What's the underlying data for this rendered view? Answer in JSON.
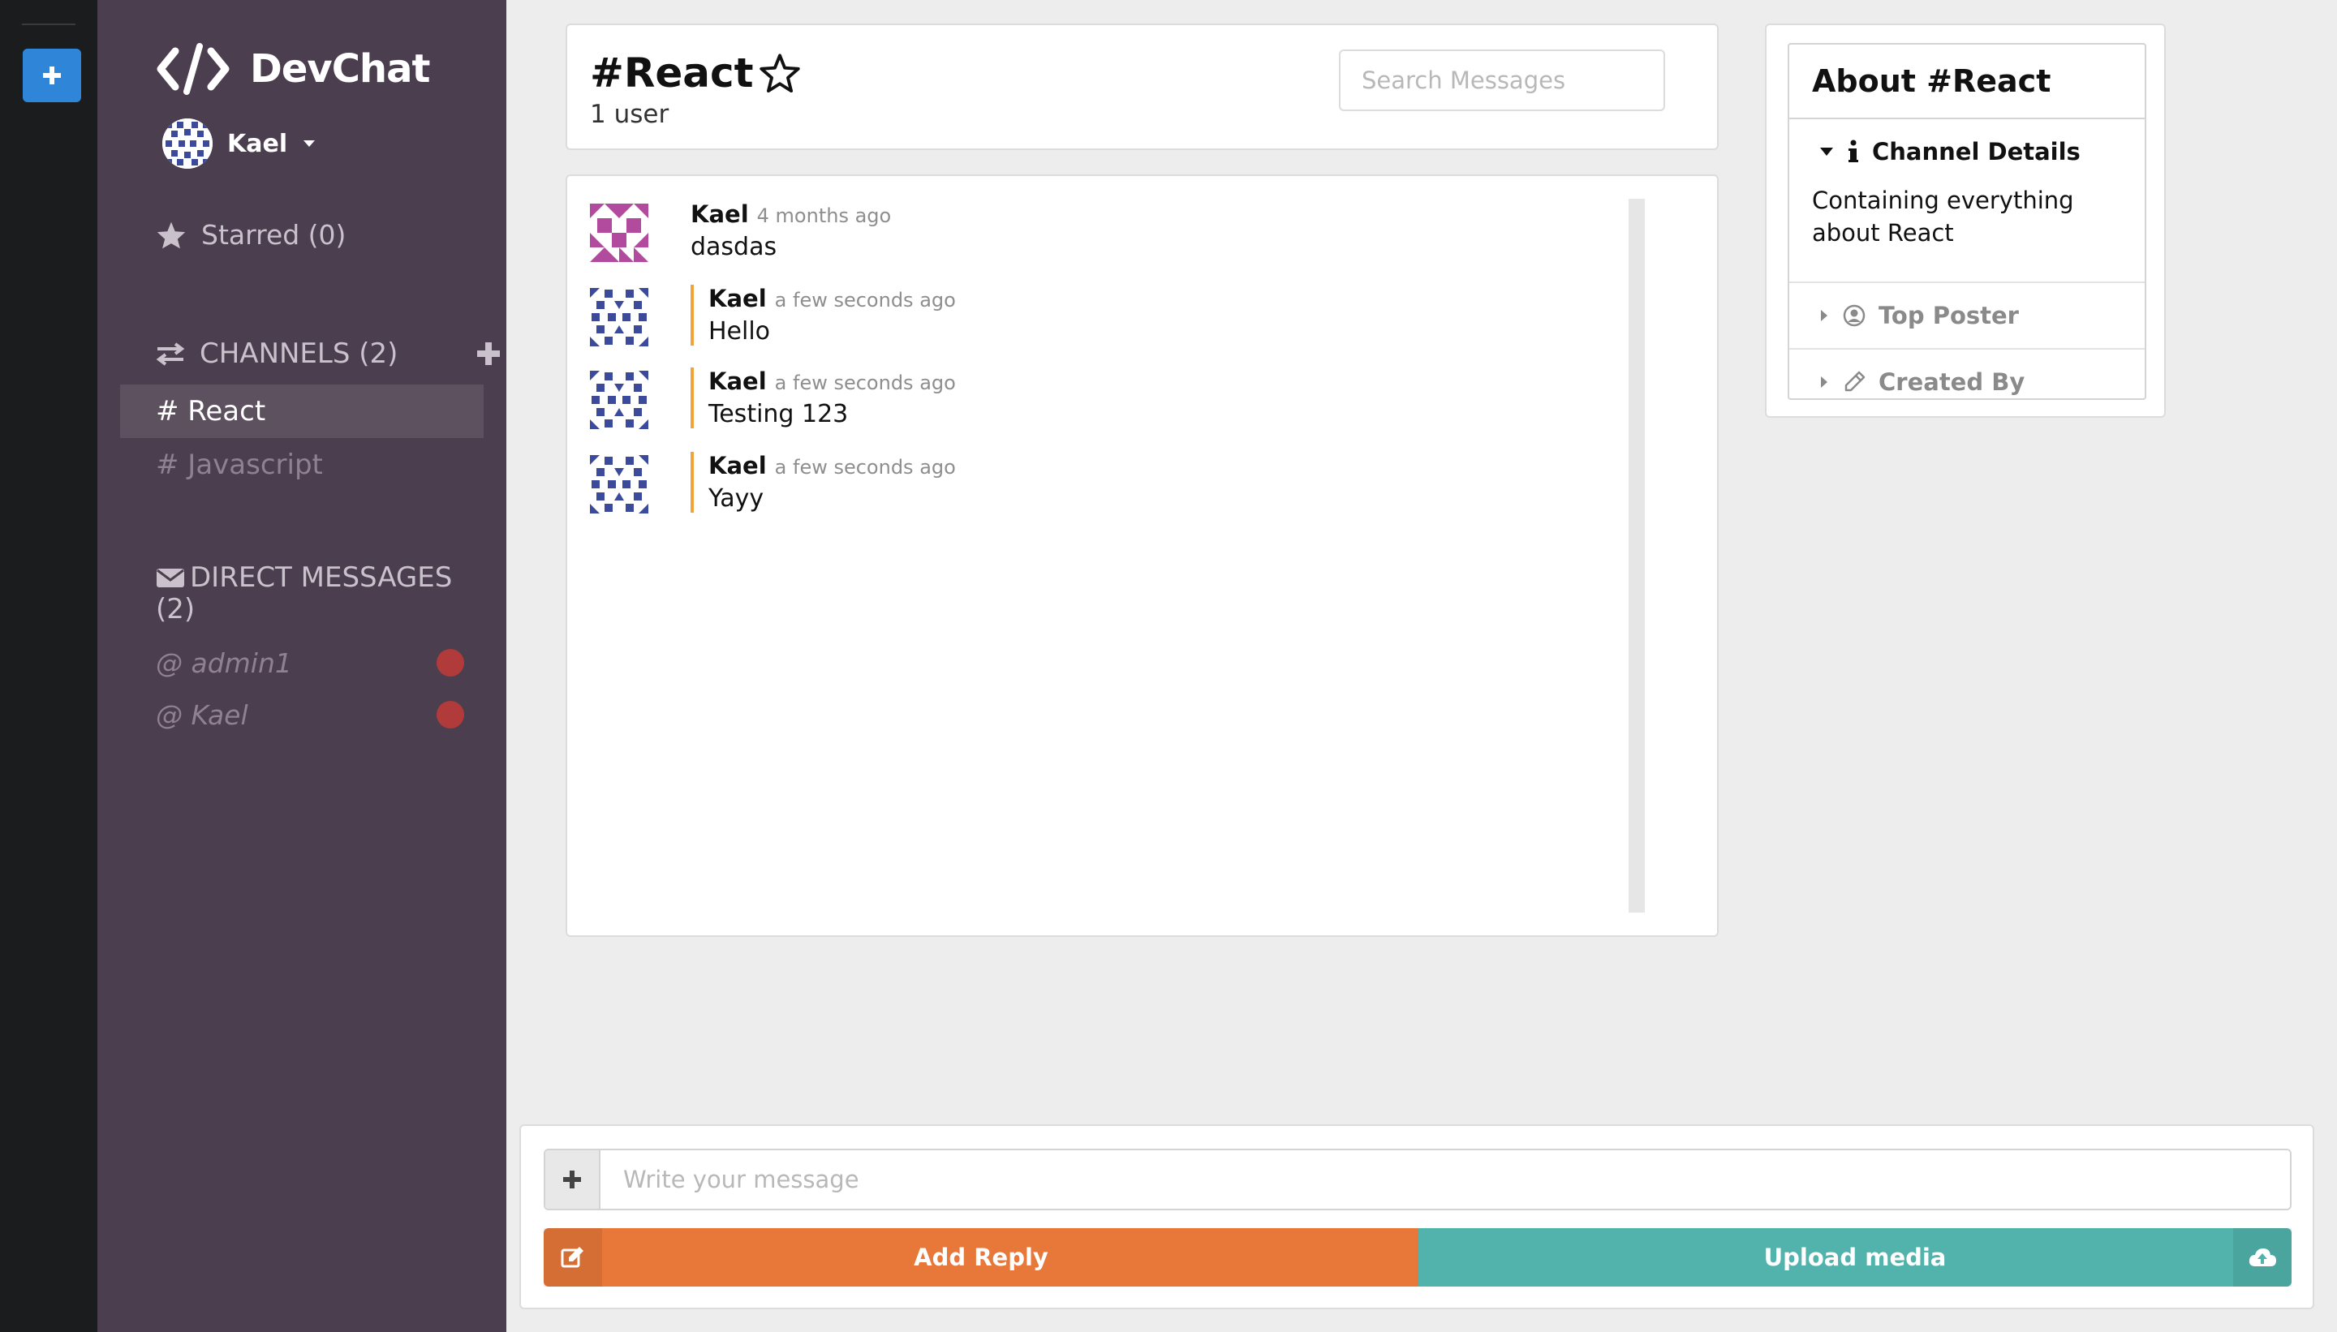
{
  "app": {
    "name": "DevChat"
  },
  "user": {
    "name": "Kael"
  },
  "sidebar": {
    "starred_label": "Starred (0)",
    "channels_label": "CHANNELS (2)",
    "channels": [
      {
        "label": "# React",
        "active": true
      },
      {
        "label": "# Javascript",
        "active": false
      }
    ],
    "dm_label": "DIRECT MESSAGES (2)",
    "direct_messages": [
      {
        "label": "@ admin1",
        "status_color": "#b13a3a"
      },
      {
        "label": "@ Kael",
        "status_color": "#b13a3a"
      }
    ]
  },
  "header": {
    "channel_title": "#React",
    "user_count": "1 user",
    "search_placeholder": "Search Messages"
  },
  "messages": [
    {
      "author": "Kael",
      "time": "4 months ago",
      "text": "dasdas",
      "own": false
    },
    {
      "author": "Kael",
      "time": "a few seconds ago",
      "text": "Hello",
      "own": true
    },
    {
      "author": "Kael",
      "time": "a few seconds ago",
      "text": "Testing 123",
      "own": true
    },
    {
      "author": "Kael",
      "time": "a few seconds ago",
      "text": "Yayy",
      "own": true
    }
  ],
  "meta": {
    "title": "About #React",
    "sections": [
      {
        "label": "Channel Details",
        "icon": "info-icon",
        "open": true,
        "content": "Containing everything about React"
      },
      {
        "label": "Top Poster",
        "icon": "user-circle-icon",
        "open": false
      },
      {
        "label": "Created By",
        "icon": "pencil-icon",
        "open": false
      }
    ]
  },
  "form": {
    "message_placeholder": "Write your message",
    "reply_label": "Add Reply",
    "upload_label": "Upload media"
  },
  "colors": {
    "rail": "#1b1c1d",
    "sidebar": "#4b3e4e",
    "accent_blue": "#2f86d9",
    "reply_orange": "#e8783a",
    "upload_teal": "#52b3ad",
    "reply_border": "#f2a33a"
  }
}
